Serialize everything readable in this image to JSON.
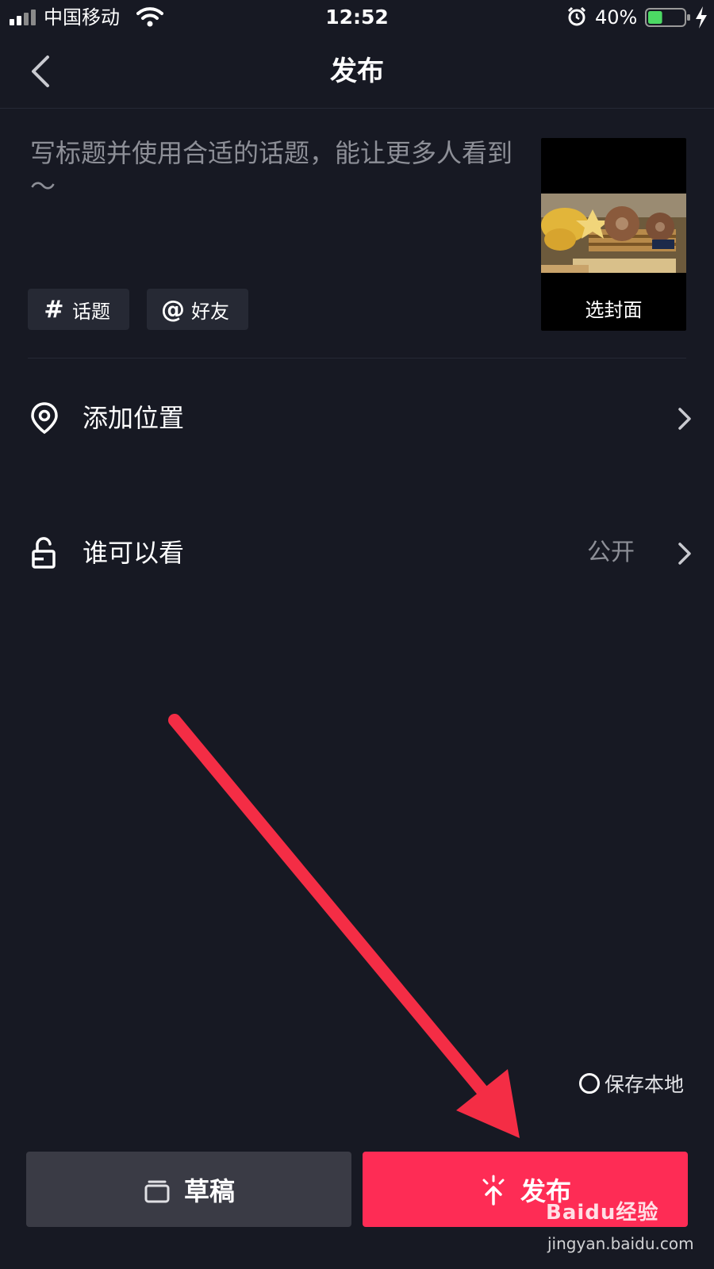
{
  "status_bar": {
    "carrier": "中国移动",
    "time": "12:52",
    "battery_percent": "40%",
    "battery_level": 0.4,
    "icons": [
      "signal-icon",
      "wifi-icon",
      "alarm-icon",
      "battery-icon",
      "charging-icon"
    ]
  },
  "nav": {
    "title": "发布",
    "back_icon": "back-chevron-icon"
  },
  "caption": {
    "placeholder": "写标题并使用合适的话题，能让更多人看到～"
  },
  "chips": {
    "topic_glyph": "#",
    "topic_label": "话题",
    "friend_glyph": "@",
    "friend_label": "好友"
  },
  "cover": {
    "label": "选封面"
  },
  "rows": {
    "location_label": "添加位置",
    "privacy_label": "谁可以看",
    "privacy_value": "公开"
  },
  "save_local": {
    "label": "保存本地",
    "checked": false
  },
  "buttons": {
    "draft_label": "草稿",
    "publish_label": "发布"
  },
  "colors": {
    "background": "#171923",
    "publish": "#fe2c55",
    "draft": "#3a3b45",
    "annotation_arrow": "#f42d45"
  },
  "watermark": {
    "logo": "Baidu经验",
    "url": "jingyan.baidu.com"
  }
}
